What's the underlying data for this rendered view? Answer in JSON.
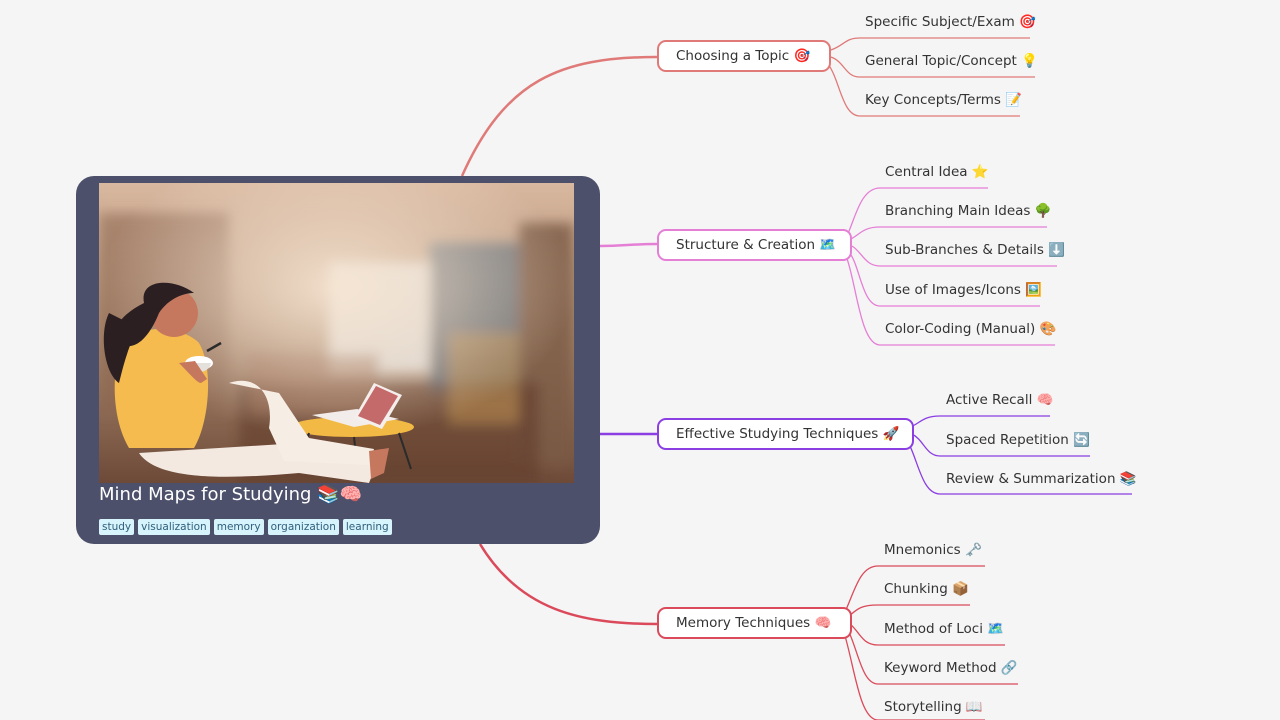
{
  "central": {
    "title": "Mind Maps for Studying 📚🧠",
    "tags": [
      "study",
      "visualization",
      "memory",
      "organization",
      "learning"
    ],
    "image": "woman-relaxing-with-laptop-illustration"
  },
  "colors": {
    "choosing": "#df7a78",
    "structure": "#e57fd6",
    "effective": "#8b3fe2",
    "memory": "#db4a5b",
    "card": "#4d506a"
  },
  "topics": [
    {
      "label": "Choosing a Topic 🎯",
      "children": [
        "Specific Subject/Exam 🎯",
        "General Topic/Concept 💡",
        "Key Concepts/Terms 📝"
      ]
    },
    {
      "label": "Structure & Creation 🗺️",
      "children": [
        "Central Idea ⭐",
        "Branching Main Ideas 🌳",
        "Sub-Branches & Details ⬇️",
        "Use of Images/Icons 🖼️",
        "Color-Coding (Manual) 🎨"
      ]
    },
    {
      "label": "Effective Studying Techniques 🚀",
      "children": [
        "Active Recall 🧠",
        "Spaced Repetition 🔄",
        "Review & Summarization 📚"
      ]
    },
    {
      "label": "Memory Techniques 🧠",
      "children": [
        "Mnemonics 🗝️",
        "Chunking 📦",
        "Method of Loci 🗺️",
        "Keyword Method 🔗",
        "Storytelling 📖"
      ]
    }
  ]
}
